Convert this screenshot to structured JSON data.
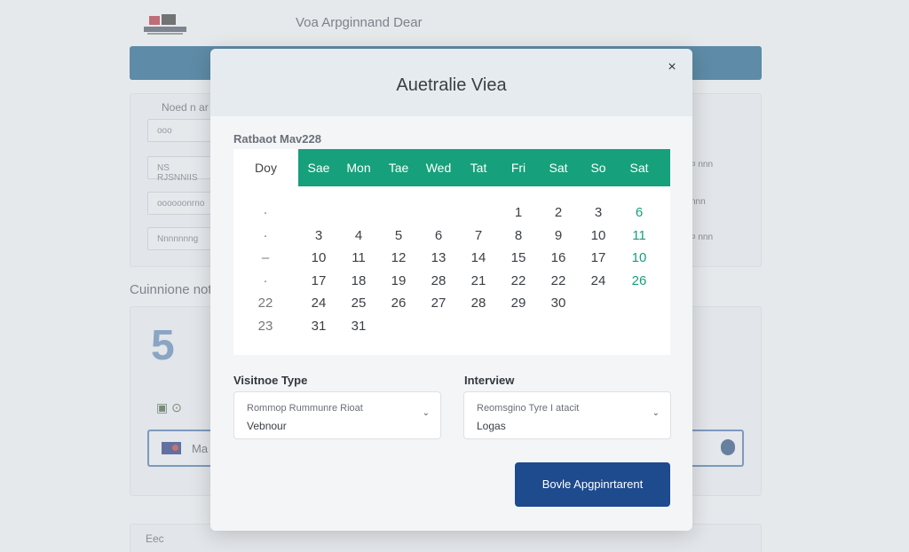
{
  "background": {
    "site_title": "Voa Arpginnand Dear",
    "panel1": {
      "label": "Noed n ar",
      "search_placeholder": "ooo",
      "fields": [
        "NS RJSNNIIS",
        "oooooonrno",
        "Nnnnnnng"
      ],
      "right_items": [
        "¤ nnn",
        "nnn",
        "¤ nnn"
      ]
    },
    "section_heading": "Cuinnione not",
    "big_number": "5",
    "selected_row_text": "Ma",
    "footer_text": "Eec"
  },
  "modal": {
    "title": "Auetralie Viea",
    "close_glyph": "×",
    "calendar_caption": "Ratbaot Mav228",
    "day_column_label": "Doy",
    "weekdays": [
      "Sae",
      "Mon",
      "Tae",
      "Wed",
      "Tat",
      "Fri",
      "Sat",
      "So",
      "Sat"
    ],
    "side_labels": [
      "·",
      "·",
      "–",
      "·",
      "22",
      "23"
    ],
    "rows": [
      [
        "",
        "",
        "",
        "",
        "",
        "1",
        "2",
        "3",
        "6"
      ],
      [
        "3",
        "4",
        "5",
        "6",
        "7",
        "8",
        "9",
        "10",
        "11"
      ],
      [
        "10",
        "11",
        "12",
        "13",
        "14",
        "15",
        "16",
        "17",
        "10"
      ],
      [
        "17",
        "18",
        "19",
        "28",
        "21",
        "22",
        "22",
        "24",
        "26"
      ],
      [
        "24",
        "25",
        "26",
        "27",
        "28",
        "29",
        "30",
        "",
        ""
      ],
      [
        "31",
        "31",
        "",
        "",
        "",
        "",
        "",
        "",
        ""
      ]
    ],
    "visa_type": {
      "label": "Visitnoe Type",
      "placeholder": "Rommop Rummunre Rioat",
      "value": "Vebnour"
    },
    "interview": {
      "label": "Interview",
      "placeholder": "Reomsgino Tyre I atacit",
      "value": "Logas"
    },
    "book_button": "Bovle Apgpinrtarent"
  },
  "colors": {
    "accent_green": "#16a07b",
    "primary_blue": "#1e4a8e",
    "nav_blue": "#1b5f86"
  }
}
